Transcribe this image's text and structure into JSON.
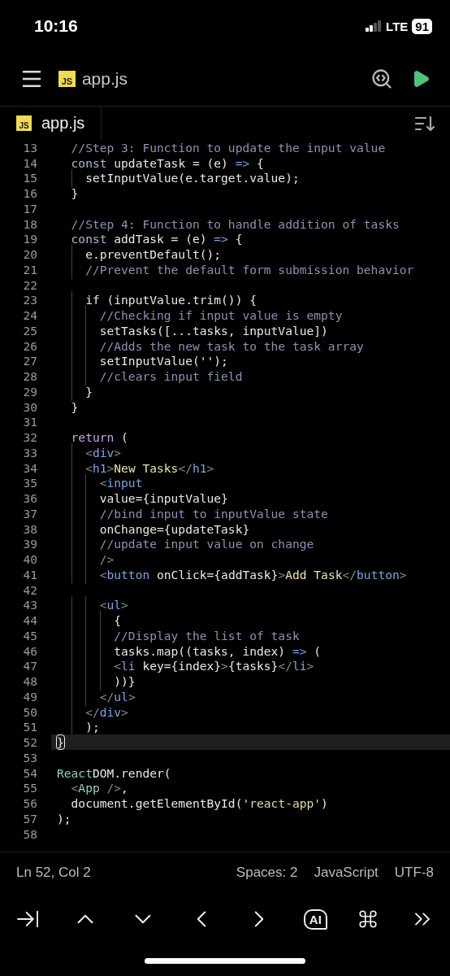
{
  "status_bar": {
    "time": "10:16",
    "network": "LTE",
    "battery": "91"
  },
  "header": {
    "file_badge": "JS",
    "title": "app.js"
  },
  "tabs": [
    {
      "badge": "JS",
      "label": "app.js",
      "selected": true
    }
  ],
  "editor": {
    "lines": [
      {
        "number": "13",
        "tokens": [
          {
            "kind": "comment",
            "text": "  //Step 3: Function to update the input value"
          }
        ]
      },
      {
        "number": "14",
        "tokens": [
          {
            "kind": "keyword",
            "text": "  const"
          },
          {
            "kind": "plain",
            "text": " updateTask = (e) "
          },
          {
            "kind": "operator",
            "text": "=>"
          },
          {
            "kind": "plain",
            "text": " {"
          }
        ]
      },
      {
        "number": "15",
        "tokens": [
          {
            "kind": "plain",
            "text": "    setInputValue(e.target.value);"
          }
        ]
      },
      {
        "number": "16",
        "tokens": [
          {
            "kind": "plain",
            "text": "  }"
          }
        ]
      },
      {
        "number": "17"
      },
      {
        "number": "18",
        "tokens": [
          {
            "kind": "comment",
            "text": "  //Step 4: Function to handle addition of tasks"
          }
        ]
      },
      {
        "number": "19",
        "tokens": [
          {
            "kind": "keyword",
            "text": "  const"
          },
          {
            "kind": "plain",
            "text": " addTask = (e) "
          },
          {
            "kind": "operator",
            "text": "=>"
          },
          {
            "kind": "plain",
            "text": " {"
          }
        ]
      },
      {
        "number": "20",
        "tokens": [
          {
            "kind": "plain",
            "text": "    e.preventDefault();"
          }
        ]
      },
      {
        "number": "21",
        "tokens": [
          {
            "kind": "comment",
            "text": "    //Prevent the default form submission behavior"
          }
        ]
      },
      {
        "number": "22"
      },
      {
        "number": "23",
        "tokens": [
          {
            "kind": "plain",
            "text": "    if (inputValue.trim()) {"
          }
        ]
      },
      {
        "number": "24",
        "tokens": [
          {
            "kind": "comment",
            "text": "      //Checking if input value is empty"
          }
        ]
      },
      {
        "number": "25",
        "tokens": [
          {
            "kind": "plain",
            "text": "      setTasks([...tasks, inputValue])"
          }
        ]
      },
      {
        "number": "26",
        "tokens": [
          {
            "kind": "comment",
            "text": "      //Adds the new task to the task array"
          }
        ]
      },
      {
        "number": "27",
        "tokens": [
          {
            "kind": "plain",
            "text": "      setInputValue('');"
          }
        ]
      },
      {
        "number": "28",
        "tokens": [
          {
            "kind": "comment",
            "text": "      //clears input field"
          }
        ]
      },
      {
        "number": "29",
        "tokens": [
          {
            "kind": "plain",
            "text": "    }"
          }
        ]
      },
      {
        "number": "30",
        "tokens": [
          {
            "kind": "plain",
            "text": "  }"
          }
        ]
      },
      {
        "number": "31"
      },
      {
        "number": "32",
        "tokens": [
          {
            "kind": "return",
            "text": "  return"
          },
          {
            "kind": "plain",
            "text": " ("
          }
        ]
      },
      {
        "number": "33",
        "tokens": [
          {
            "kind": "punct",
            "text": "    <"
          },
          {
            "kind": "tag",
            "text": "div"
          },
          {
            "kind": "punct",
            "text": ">"
          }
        ]
      },
      {
        "number": "34",
        "tokens": [
          {
            "kind": "punct",
            "text": "    <"
          },
          {
            "kind": "tag",
            "text": "h1"
          },
          {
            "kind": "punct",
            "text": ">"
          },
          {
            "kind": "jsx",
            "text": "New Tasks"
          },
          {
            "kind": "punct",
            "text": "</"
          },
          {
            "kind": "tag",
            "text": "h1"
          },
          {
            "kind": "punct",
            "text": ">"
          }
        ]
      },
      {
        "number": "35",
        "tokens": [
          {
            "kind": "punct",
            "text": "      <"
          },
          {
            "kind": "tag",
            "text": "input"
          }
        ]
      },
      {
        "number": "36",
        "tokens": [
          {
            "kind": "plain",
            "text": "      value={inputValue}"
          }
        ]
      },
      {
        "number": "37",
        "tokens": [
          {
            "kind": "comment",
            "text": "      //bind input to inputValue state"
          }
        ]
      },
      {
        "number": "38",
        "tokens": [
          {
            "kind": "plain",
            "text": "      onChange={updateTask}"
          }
        ]
      },
      {
        "number": "39",
        "tokens": [
          {
            "kind": "comment",
            "text": "      //update input value on change"
          }
        ]
      },
      {
        "number": "40",
        "tokens": [
          {
            "kind": "punct",
            "text": "      />"
          }
        ]
      },
      {
        "number": "41",
        "tokens": [
          {
            "kind": "punct",
            "text": "      <"
          },
          {
            "kind": "tag",
            "text": "button"
          },
          {
            "kind": "plain",
            "text": " onClick={addTask}"
          },
          {
            "kind": "punct",
            "text": ">"
          },
          {
            "kind": "jsx",
            "text": "Add Task"
          },
          {
            "kind": "punct",
            "text": "</"
          },
          {
            "kind": "tag",
            "text": "button"
          },
          {
            "kind": "punct",
            "text": ">"
          }
        ]
      },
      {
        "number": "42"
      },
      {
        "number": "43",
        "tokens": [
          {
            "kind": "punct",
            "text": "      <"
          },
          {
            "kind": "tag",
            "text": "ul"
          },
          {
            "kind": "punct",
            "text": ">"
          }
        ]
      },
      {
        "number": "44",
        "tokens": [
          {
            "kind": "plain",
            "text": "        {"
          }
        ]
      },
      {
        "number": "45",
        "tokens": [
          {
            "kind": "comment",
            "text": "        //Display the list of task"
          }
        ]
      },
      {
        "number": "46",
        "tokens": [
          {
            "kind": "plain",
            "text": "        tasks.map((tasks, index) "
          },
          {
            "kind": "operator",
            "text": "=>"
          },
          {
            "kind": "plain",
            "text": " ("
          }
        ]
      },
      {
        "number": "47",
        "tokens": [
          {
            "kind": "punct",
            "text": "        <"
          },
          {
            "kind": "tag",
            "text": "li"
          },
          {
            "kind": "plain",
            "text": " key={index}"
          },
          {
            "kind": "punct",
            "text": ">"
          },
          {
            "kind": "plain",
            "text": "{tasks}"
          },
          {
            "kind": "punct",
            "text": "</"
          },
          {
            "kind": "tag",
            "text": "li"
          },
          {
            "kind": "punct",
            "text": ">"
          }
        ]
      },
      {
        "number": "48",
        "tokens": [
          {
            "kind": "plain",
            "text": "        ))}"
          }
        ]
      },
      {
        "number": "49",
        "tokens": [
          {
            "kind": "punct",
            "text": "      </"
          },
          {
            "kind": "tag",
            "text": "ul"
          },
          {
            "kind": "punct",
            "text": ">"
          }
        ]
      },
      {
        "number": "50",
        "tokens": [
          {
            "kind": "punct",
            "text": "    </"
          },
          {
            "kind": "tag",
            "text": "div"
          },
          {
            "kind": "punct",
            "text": ">"
          }
        ]
      },
      {
        "number": "51",
        "tokens": [
          {
            "kind": "plain",
            "text": "    );"
          }
        ]
      },
      {
        "number": "52",
        "current": true,
        "tokens": [
          {
            "kind": "bracket_match",
            "text": "}"
          }
        ]
      },
      {
        "number": "53"
      },
      {
        "number": "54",
        "tokens": [
          {
            "kind": "class",
            "text": "React"
          },
          {
            "kind": "plain",
            "text": "DOM.render("
          }
        ]
      },
      {
        "number": "55",
        "tokens": [
          {
            "kind": "punct",
            "text": "  <"
          },
          {
            "kind": "class",
            "text": "App"
          },
          {
            "kind": "punct",
            "text": " />"
          },
          {
            "kind": "plain",
            "text": ","
          }
        ]
      },
      {
        "number": "56",
        "tokens": [
          {
            "kind": "plain",
            "text": "  document.getElementById("
          },
          {
            "kind": "string",
            "text": "'react-app'"
          },
          {
            "kind": "plain",
            "text": ")"
          }
        ]
      },
      {
        "number": "57",
        "tokens": [
          {
            "kind": "plain",
            "text": ");"
          }
        ]
      },
      {
        "number": "58"
      }
    ]
  },
  "footer": {
    "position": "Ln 52, Col 2",
    "indent": "Spaces: 2",
    "language": "JavaScript",
    "encoding": "UTF-8"
  },
  "keyboard_bar": {
    "ai_label": "AI"
  }
}
